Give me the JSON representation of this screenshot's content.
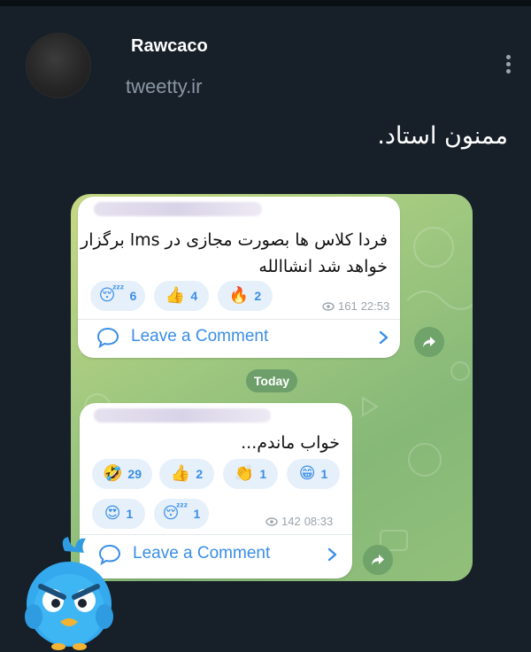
{
  "post": {
    "username": "Rawcaco",
    "handle": "tweetty.ir",
    "text": "ممنون استاد."
  },
  "chat": {
    "day_separator": "Today",
    "messages": [
      {
        "text_line1": "فردا کلاس ها بصورت مجازی در lms برگزار",
        "text_line2": "خواهد شد انشاالله",
        "reactions": [
          {
            "icon": "sleeping-face-emoji",
            "glyph": "😴",
            "count": "6"
          },
          {
            "icon": "thumbs-up-emoji",
            "glyph": "👍",
            "count": "4"
          },
          {
            "icon": "fire-emoji",
            "glyph": "🔥",
            "count": "2"
          }
        ],
        "views": "161",
        "time": "22:53",
        "comment_label": "Leave a Comment"
      },
      {
        "text_line1": "خواب ماندم...",
        "reactions": [
          {
            "icon": "rolling-laughing-emoji",
            "glyph": "🤣",
            "count": "29"
          },
          {
            "icon": "thumbs-up-emoji",
            "glyph": "👍",
            "count": "2"
          },
          {
            "icon": "clapping-hands-emoji",
            "glyph": "👏",
            "count": "1"
          },
          {
            "icon": "grinning-face-emoji",
            "glyph": "😁",
            "count": "1"
          },
          {
            "icon": "heart-eyes-emoji",
            "glyph": "😍",
            "count": "1"
          },
          {
            "icon": "sleeping-face-emoji",
            "glyph": "😴",
            "count": "1"
          }
        ],
        "views": "142",
        "time": "08:33",
        "comment_label": "Leave a Comment"
      }
    ]
  },
  "colors": {
    "background": "#172029",
    "link_blue": "#3a8ee6",
    "chat_green": "#9ec77f"
  }
}
